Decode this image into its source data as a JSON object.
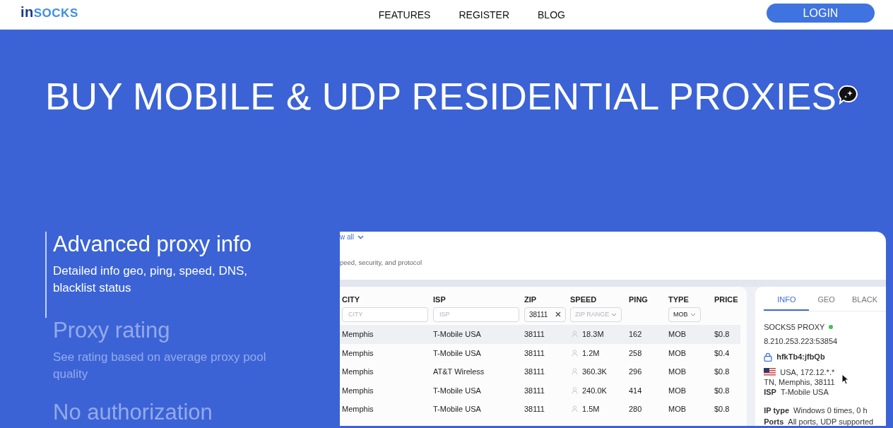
{
  "header": {
    "logo": {
      "prefix": "in",
      "suffix": "SOCKS"
    },
    "nav": [
      "FEATURES",
      "REGISTER",
      "BLOG"
    ],
    "login": "LOGIN"
  },
  "hero": {
    "title": "BUY MOBILE & UDP RESIDENTIAL PROXIES"
  },
  "features": [
    {
      "title": "Advanced proxy info",
      "text": "Detailed info geo, ping, speed, DNS, blacklist status",
      "selected": true
    },
    {
      "title": "Proxy rating",
      "text": "See rating based on average proxy pool quality",
      "selected": false
    },
    {
      "title": "No authorization",
      "selected": false
    }
  ],
  "panel": {
    "link": "w all",
    "subtitle": "peed, security, and protocol",
    "table": {
      "columns": [
        "CITY",
        "ISP",
        "ZIP",
        "SPEED",
        "PING",
        "TYPE",
        "PRICE"
      ],
      "filters": {
        "city_placeholder": "CITY",
        "isp_placeholder": "ISP",
        "zip_value": "38111",
        "speed_placeholder": "ZIP RANGE",
        "type_value": "MOB"
      },
      "rows": [
        {
          "city": "Memphis",
          "isp": "T-Mobile USA",
          "zip": "38111",
          "speed": "18.3M",
          "ping": "162",
          "type": "MOB",
          "price": "$0.8",
          "selected": true
        },
        {
          "city": "Memphis",
          "isp": "T-Mobile USA",
          "zip": "38111",
          "speed": "1.2M",
          "ping": "258",
          "type": "MOB",
          "price": "$0.4",
          "selected": false
        },
        {
          "city": "Memphis",
          "isp": "AT&T Wireless",
          "zip": "38111",
          "speed": "360.3K",
          "ping": "296",
          "type": "MOB",
          "price": "$0.8",
          "selected": false
        },
        {
          "city": "Memphis",
          "isp": "T-Mobile USA",
          "zip": "38111",
          "speed": "240.0K",
          "ping": "414",
          "type": "MOB",
          "price": "$0.8",
          "selected": false
        },
        {
          "city": "Memphis",
          "isp": "T-Mobile USA",
          "zip": "38111",
          "speed": "1.5M",
          "ping": "280",
          "type": "MOB",
          "price": "$0.8",
          "selected": false
        }
      ]
    },
    "info": {
      "tabs": [
        {
          "label": "INFO",
          "selected": true
        },
        {
          "label": "GEO",
          "selected": false
        },
        {
          "label": "BLACK",
          "selected": false
        }
      ],
      "proxy_type": "SOCKS5 PROXY",
      "online": true,
      "address": "8.210.253.223:53854",
      "credentials": "hfkTb4:jfbQb",
      "location": "USA, 172.12.*.*",
      "region": "TN, Memphis, 38111",
      "details": [
        {
          "label": "ISP",
          "value": "T-Mobile USA"
        },
        {
          "label": "IP type",
          "value": "Windows 0 times, 0 h"
        },
        {
          "label": "Ports",
          "value": "All ports, UDP supported"
        }
      ]
    }
  }
}
